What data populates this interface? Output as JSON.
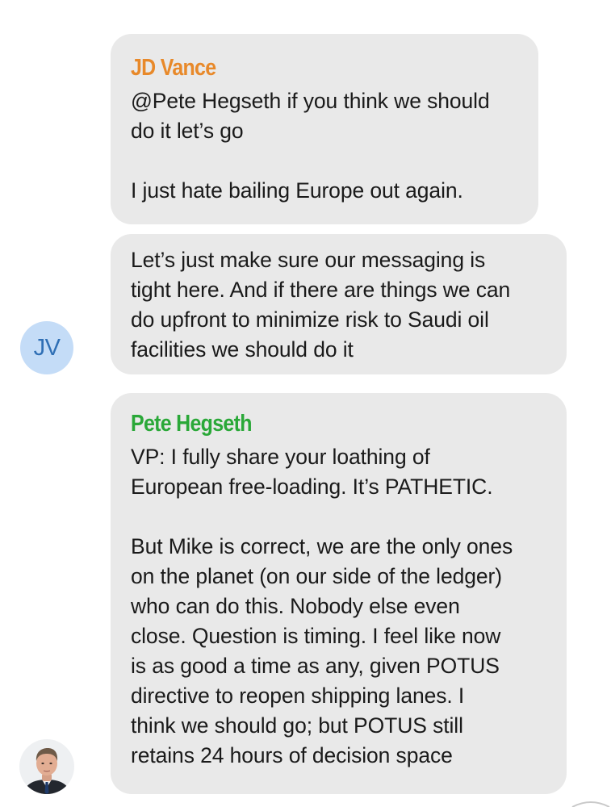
{
  "colors": {
    "bubble_bg": "#e9e9e9",
    "jd_vance_name": "#e8892a",
    "pete_hegseth_name": "#2aa838",
    "avatar_bg": "#c4dcf7",
    "avatar_text": "#2f6fb5"
  },
  "messages": [
    {
      "sender": "JD Vance",
      "lines": [
        "@Pete Hegseth if you think we should",
        "do it let’s go",
        "",
        "I just hate bailing Europe out again."
      ]
    },
    {
      "sender": "",
      "lines": [
        "Let’s just make sure our messaging is",
        "tight here. And if there are things we can",
        "do upfront to minimize risk to Saudi oil",
        "facilities we should do it"
      ]
    },
    {
      "sender": "Pete Hegseth",
      "lines": [
        "VP: I fully share your loathing of",
        "European free-loading. It’s PATHETIC.",
        "",
        "But Mike is correct, we are the only ones",
        "on the planet (on our side of the ledger)",
        "who can do this.  Nobody else even",
        "close.  Question is timing. I feel like now",
        "is as good a time as any, given POTUS",
        "directive to reopen shipping lanes. I",
        "think we should go; but POTUS still",
        "retains 24 hours of decision space"
      ]
    }
  ],
  "avatars": {
    "jv_initials": "JV",
    "hegseth_photo_icon": "person-photo-icon"
  }
}
